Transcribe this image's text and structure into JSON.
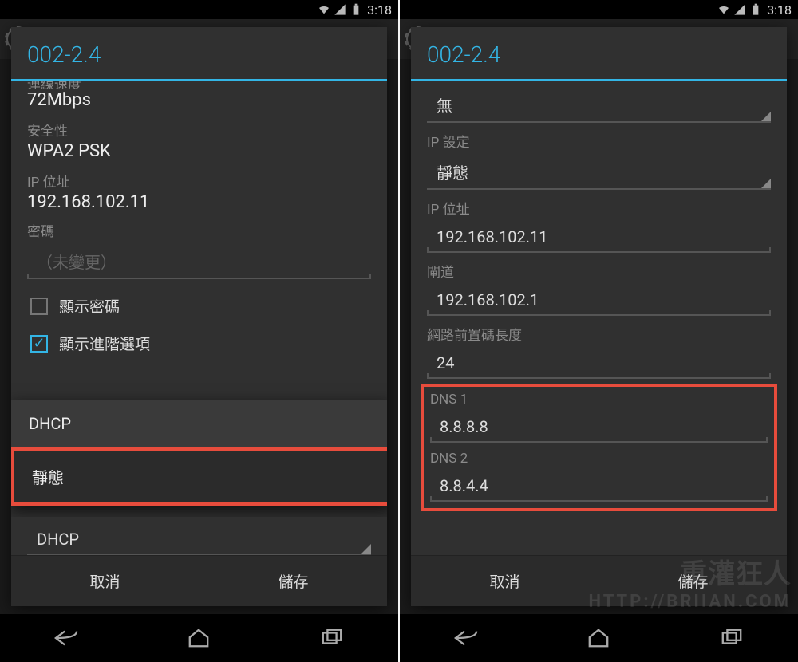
{
  "status": {
    "time": "3:18"
  },
  "left": {
    "title": "002-2.4",
    "speed_label_cut": "連線速度",
    "speed_value": "72Mbps",
    "security_label": "安全性",
    "security_value": "WPA2 PSK",
    "ip_label": "IP 位址",
    "ip_value": "192.168.102.11",
    "password_label": "密碼",
    "password_placeholder": "（未變更）",
    "show_password": "顯示密碼",
    "show_advanced": "顯示進階選項",
    "dropdown": {
      "option_dhcp": "DHCP",
      "option_static": "靜態"
    },
    "spinner_below_value": "DHCP",
    "cancel": "取消",
    "save": "儲存"
  },
  "right": {
    "title": "002-2.4",
    "proxy_value": "無",
    "ip_settings_label": "IP 設定",
    "ip_settings_value": "靜態",
    "ip_label": "IP 位址",
    "ip_value": "192.168.102.11",
    "gateway_label": "閘道",
    "gateway_value": "192.168.102.1",
    "prefix_label": "網路前置碼長度",
    "prefix_value": "24",
    "dns1_label": "DNS 1",
    "dns1_value": "8.8.8.8",
    "dns2_label": "DNS 2",
    "dns2_value": "8.8.4.4",
    "cancel": "取消",
    "save": "儲存"
  },
  "watermark": {
    "line1": "重灌狂人",
    "line2": "HTTP://BRIIAN.COM"
  }
}
